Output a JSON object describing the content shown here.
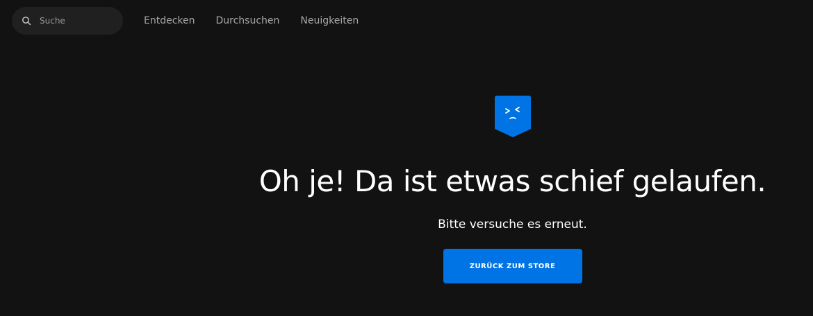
{
  "header": {
    "search": {
      "placeholder": "Suche",
      "value": ""
    },
    "nav": [
      {
        "label": "Entdecken"
      },
      {
        "label": "Durchsuchen"
      },
      {
        "label": "Neuigkeiten"
      }
    ]
  },
  "error": {
    "icon": "upset-face-shield-icon",
    "headline": "Oh je! Da ist etwas schief gelaufen.",
    "subtext": "Bitte versuche es erneut.",
    "button_label": "ZURÜCK ZUM STORE"
  },
  "colors": {
    "background": "#121212",
    "search_background": "#202020",
    "accent": "#0074e4",
    "nav_text": "#a8a8a8"
  }
}
